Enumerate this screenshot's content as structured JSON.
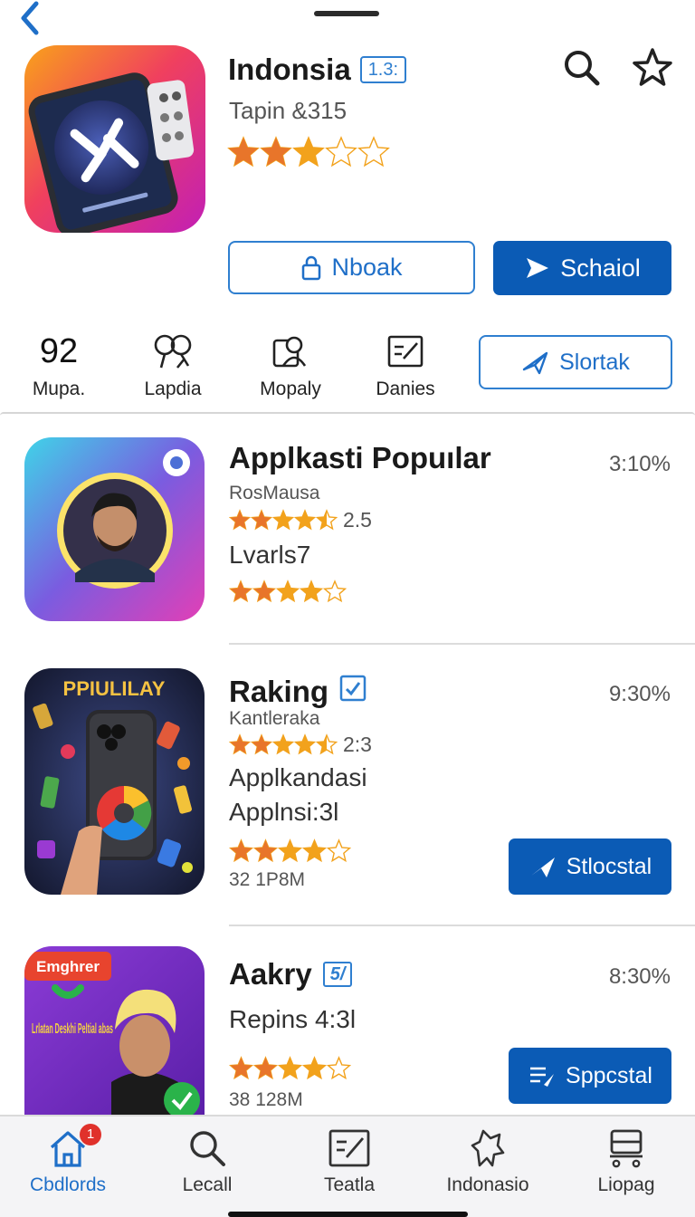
{
  "header": {
    "app_title": "Indonsia",
    "version": "1.3:",
    "subtitle": "Tapin &315",
    "rating_stars": 3,
    "secondary_button": "Nboak",
    "primary_button": "Schaiol"
  },
  "stats": [
    {
      "value": "92",
      "label": "Mupa."
    },
    {
      "value": "",
      "label": "Lapdia",
      "icon": "rating-icon"
    },
    {
      "value": "",
      "label": "Mopaly",
      "icon": "contacts-icon"
    },
    {
      "value": "",
      "label": "Danies",
      "icon": "edit-icon"
    }
  ],
  "stats_button": "Slortak",
  "list": [
    {
      "title": "Applkasti Popuılar",
      "percent": "3:10%",
      "developer": "RosMausa",
      "rating": "2.5",
      "rating_stars": 4.5,
      "line": "Lvarls7",
      "stars2": 4
    },
    {
      "title": "Raking",
      "percent": "9:30%",
      "developer": "Kantleraka",
      "rating": "2:3",
      "rating_stars": 4.5,
      "line1": "Applkandasi",
      "line2": "Applnsi:3l",
      "stars2": 4,
      "meta": "32  1P8M",
      "button": "Stlocstal",
      "icon_caption": "PPIULILAY"
    },
    {
      "title": "Aakry",
      "badge": "5/",
      "percent": "8:30%",
      "line": "Repins 4:3l",
      "stars2": 4,
      "meta": "38  128M",
      "button": "Sppcstal",
      "icon_caption": "Emghrer",
      "icon_text": "Lrlatan Deskhi Peltial abas"
    }
  ],
  "tabs": [
    {
      "label": "Cbdlords",
      "badge": "1"
    },
    {
      "label": "Lecall"
    },
    {
      "label": "Teatla"
    },
    {
      "label": "Indonasio"
    },
    {
      "label": "Liopag"
    }
  ],
  "colors": {
    "accent": "#1f6fc8",
    "primary_button": "#0b5bb5",
    "star": "#f2a21c",
    "star_empty": "#f2a21c",
    "badge_red": "#e0312b"
  }
}
